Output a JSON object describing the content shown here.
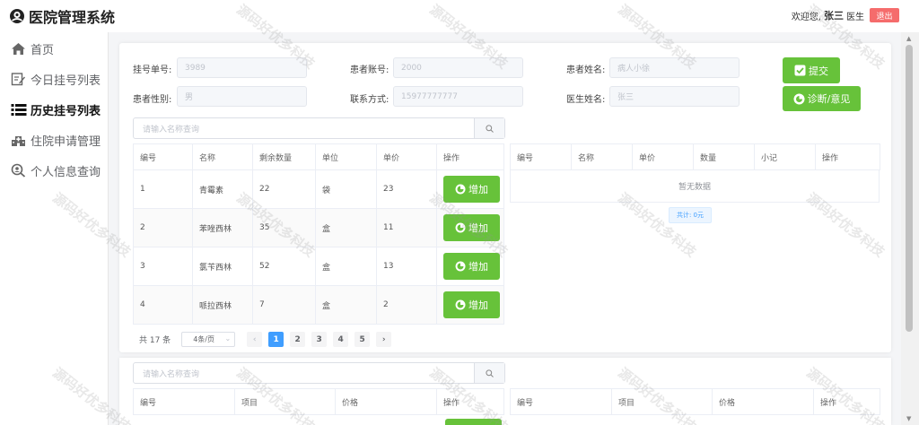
{
  "app": {
    "title": "医院管理系统"
  },
  "user": {
    "welcome": "欢迎您,",
    "name": "张三",
    "role": "医生",
    "logout_label": "退出"
  },
  "sidebar": {
    "items": [
      {
        "label": "首页",
        "icon": "home-icon"
      },
      {
        "label": "今日挂号列表",
        "icon": "edit-list-icon"
      },
      {
        "label": "历史挂号列表",
        "icon": "list-icon"
      },
      {
        "label": "住院申请管理",
        "icon": "hospital-icon"
      },
      {
        "label": "个人信息查询",
        "icon": "search-user-icon"
      }
    ],
    "active_index": 2
  },
  "form": {
    "reg_no": {
      "label": "挂号单号:",
      "value": "3989"
    },
    "patient_account": {
      "label": "患者账号:",
      "value": "2000"
    },
    "patient_name": {
      "label": "患者姓名:",
      "value": "病人小徐"
    },
    "patient_gender": {
      "label": "患者性别:",
      "value": "男"
    },
    "phone": {
      "label": "联系方式:",
      "value": "15977777777"
    },
    "doctor_name": {
      "label": "医生姓名:",
      "value": "张三"
    },
    "submit_label": "提交",
    "diagnosis_label": "诊断/意见"
  },
  "medicine_search": {
    "placeholder": "请输入名称查询"
  },
  "medicine_table": {
    "headers": [
      "编号",
      "名称",
      "剩余数量",
      "单位",
      "单价",
      "操作"
    ],
    "rows": [
      {
        "id": "1",
        "name": "青霉素",
        "stock": "22",
        "unit": "袋",
        "price": "23"
      },
      {
        "id": "2",
        "name": "苯唑西林",
        "stock": "35",
        "unit": "盒",
        "price": "11"
      },
      {
        "id": "3",
        "name": "氯苄西林",
        "stock": "52",
        "unit": "盒",
        "price": "13"
      },
      {
        "id": "4",
        "name": "哌拉西林",
        "stock": "7",
        "unit": "盒",
        "price": "2"
      }
    ],
    "add_label": "增加"
  },
  "selected_table": {
    "headers": [
      "编号",
      "名称",
      "单价",
      "数量",
      "小记",
      "操作"
    ],
    "empty_text": "暂无数据",
    "total_label": "共计: 0元"
  },
  "pagination": {
    "total_text": "共 17 条",
    "page_size": "4条/页",
    "pages": [
      "1",
      "2",
      "3",
      "4",
      "5"
    ],
    "current": 1,
    "prev": "‹",
    "next": "›"
  },
  "item_search": {
    "placeholder": "请输入名称查询"
  },
  "item_table": {
    "headers": [
      "编号",
      "项目",
      "价格",
      "操作"
    ]
  },
  "selected_item_table": {
    "headers": [
      "编号",
      "项目",
      "价格",
      "操作"
    ]
  },
  "watermark": "源码好优多科技",
  "colors": {
    "green": "#67c23a",
    "blue": "#409eff",
    "red": "#f56c6c"
  }
}
